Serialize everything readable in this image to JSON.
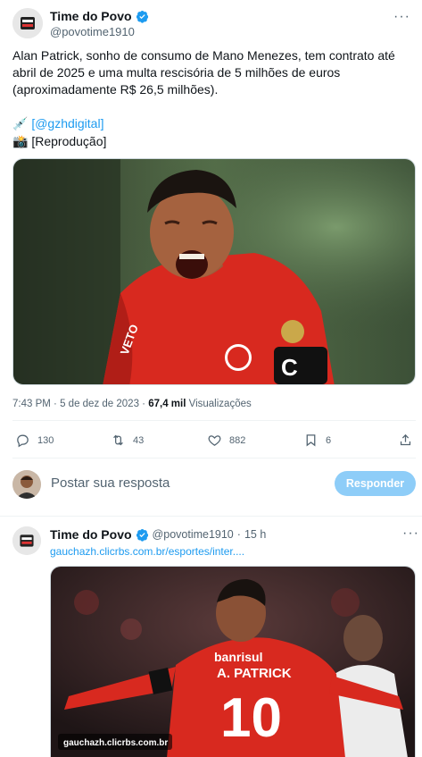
{
  "main_tweet": {
    "author_name": "Time do Povo",
    "author_handle": "@povotime1910",
    "body": "Alan Patrick, sonho de consumo de Mano Menezes, tem contrato até abril de 2025 e uma multa rescisória de 5 milhões de euros (aproximadamente R$ 26,5 milhões).",
    "credit1_emoji": "💉",
    "credit1_text": "[@gzhdigital]",
    "credit2_emoji": "📸",
    "credit2_text": "[Reprodução]",
    "time": "7:43 PM",
    "sep": "·",
    "date": "5 de dez de 2023",
    "views_count": "67,4 mil",
    "views_label": "Visualizações",
    "replies": "130",
    "retweets": "43",
    "likes": "882",
    "bookmarks": "6"
  },
  "reply_box": {
    "placeholder": "Postar sua resposta",
    "button_label": "Responder"
  },
  "second_tweet": {
    "author_name": "Time do Povo",
    "author_handle": "@povotime1910",
    "dot": "·",
    "age": "15 h",
    "url_text": "gauchazh.clicrbs.com.br/esportes/inter....",
    "image_caption": "gauchazh.clicrbs.com.br",
    "jersey_name": "A. PATRICK",
    "jersey_number": "10",
    "sponsor": "banrisul"
  },
  "image_main": {
    "sleeve": "VETO"
  },
  "colors": {
    "accent": "#1d9bf0",
    "reply_button": "#8ecdf8",
    "jersey_red": "#d8291f"
  }
}
